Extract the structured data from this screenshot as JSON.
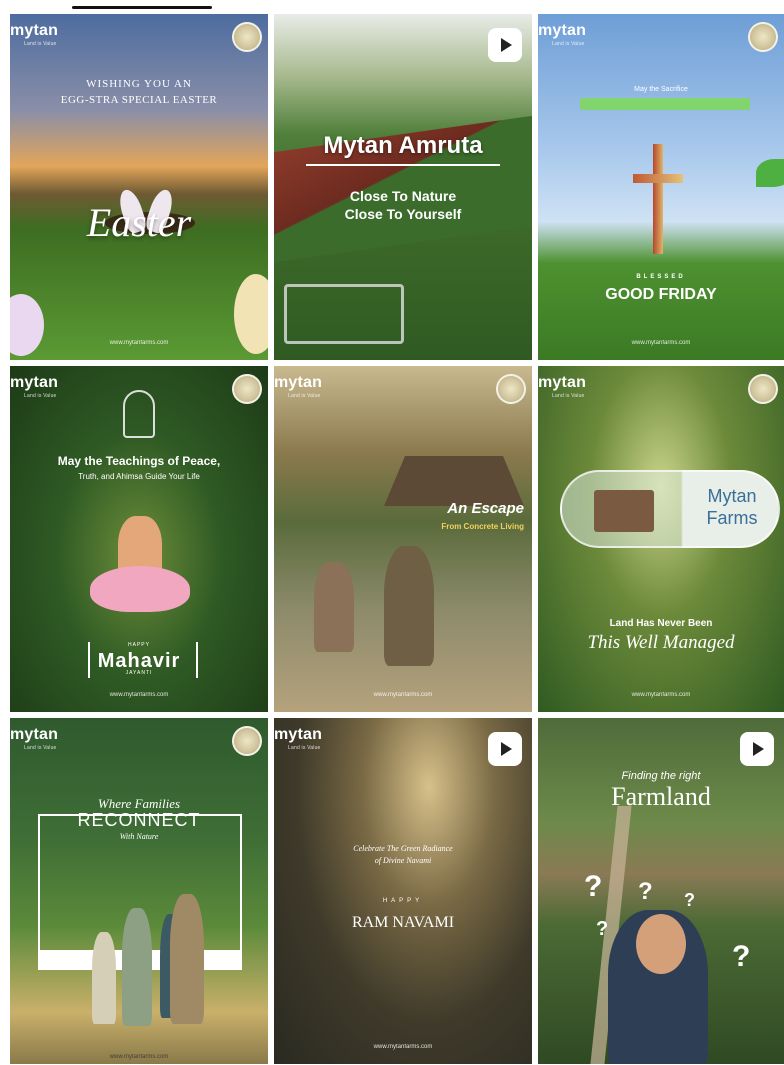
{
  "brand": {
    "logo_text": "mytan",
    "logo_sub": "Land is Value",
    "website": "www.mytanfarms.com"
  },
  "posts": [
    {
      "id": "easter",
      "line1": "WISHING YOU AN",
      "line2": "EGG-STRA SPECIAL EASTER",
      "script_text": "Easter",
      "colors": {
        "sky": "#4f6fa3",
        "grass": "#3f7a2a"
      }
    },
    {
      "id": "amruta",
      "title": "Mytan Amruta",
      "subtitle1": "Close To Nature",
      "subtitle2": "Close To Yourself",
      "colors": {
        "banner": "#7a2a20"
      }
    },
    {
      "id": "good-friday",
      "line1": "May the Sacrifice",
      "line2": "",
      "small_label": "BLESSED",
      "title": "GOOD FRIDAY",
      "colors": {
        "sky": "#8fb8e0",
        "green": "#7ed957"
      }
    },
    {
      "id": "mahavir",
      "line1": "May the Teachings of Peace,",
      "line2": "Truth, and Ahimsa Guide Your Life",
      "small_top": "HAPPY",
      "title": "Mahavir",
      "small_bottom": "JAYANTI"
    },
    {
      "id": "escape",
      "title": "An Escape",
      "subtitle": "From Concrete Living"
    },
    {
      "id": "farms",
      "pill_line1": "Mytan",
      "pill_line2": "Farms",
      "line1": "Land Has Never Been",
      "line2": "This Well Managed"
    },
    {
      "id": "reconnect",
      "line1": "Where Families",
      "title": "RECONNECT",
      "line2": "With Nature"
    },
    {
      "id": "ram-navami",
      "line1": "Celebrate The Green Radiance",
      "line2": "of Divine Navami",
      "small_label": "HAPPY",
      "title": "RAM NAVAMI"
    },
    {
      "id": "farmland",
      "line1": "Finding the right",
      "title": "Farmland",
      "marks": "?"
    }
  ]
}
